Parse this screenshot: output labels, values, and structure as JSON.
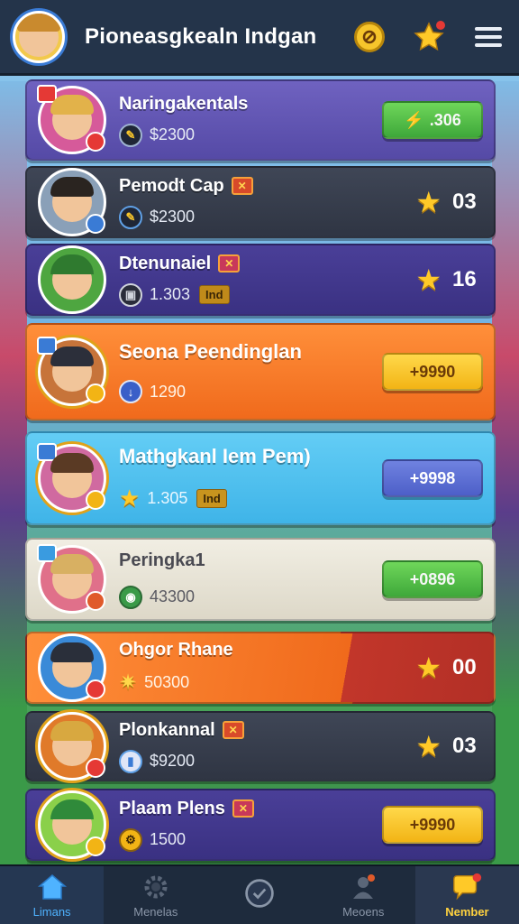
{
  "header": {
    "title": "Pioneasgkealn Indgan",
    "icons": [
      "avatar",
      "coin-icon",
      "star-icon",
      "menu-icon"
    ]
  },
  "players": [
    {
      "name": "Naringakentals",
      "value": "$2300",
      "action": ".306",
      "style": "purple",
      "action_type": "green"
    },
    {
      "name": "Pemodt Cap",
      "value": "$2300",
      "stars": "03",
      "style": "dark"
    },
    {
      "name": "Dtenunaiel",
      "value": "1.303",
      "chip": "Ind",
      "stars": "16",
      "style": "navy"
    },
    {
      "name": "Seona Peendinglan",
      "value": "1290",
      "action": "+9990",
      "style": "orange",
      "action_type": "yellow"
    },
    {
      "name": "Mathgkanl Iem Pem)",
      "value": "1.305",
      "chip": "Ind",
      "action": "+9998",
      "style": "sky",
      "action_type": "blue"
    },
    {
      "name": "Peringka1",
      "value": "43300",
      "action": "+0896",
      "style": "cream",
      "action_type": "green"
    },
    {
      "name": "Ohgor Rhane",
      "value": "50300",
      "stars": "00",
      "style": "orange-red"
    },
    {
      "name": "Plonkannal",
      "value": "$9200",
      "stars": "03",
      "style": "dark"
    },
    {
      "name": "Plaam Plens",
      "value": "1500",
      "action": "+9990",
      "style": "navy",
      "action_type": "yellow"
    }
  ],
  "bottom_nav": [
    {
      "label": "Limans"
    },
    {
      "label": "Menelas"
    },
    {
      "label": ""
    },
    {
      "label": "Meoens"
    },
    {
      "label": "Nember"
    }
  ],
  "colors": {
    "topbar": "#24344a",
    "accent_yellow": "#ffc928",
    "accent_green": "#3ea83a",
    "nav_active_blue": "#4fb3ff"
  }
}
